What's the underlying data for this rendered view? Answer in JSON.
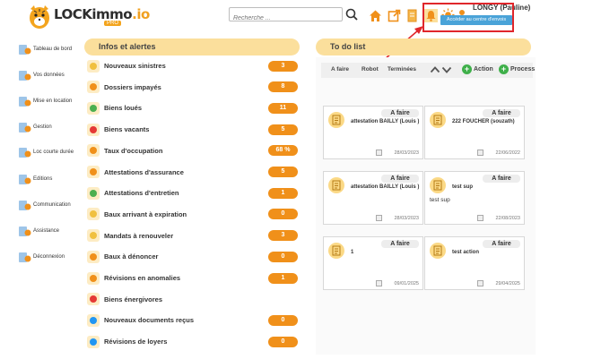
{
  "header": {
    "brand_main": "LOCKimmo",
    "brand_accent": ".io",
    "brand_badge": "PRO",
    "search_placeholder": "Recherche ...",
    "user_name": "LONGY (Pauline)",
    "tooltip": "Accéder au centre d'envois",
    "icons": [
      "home-icon",
      "external-link-icon",
      "document-icon",
      "notification-center-icon",
      "sun-icon",
      "status-dot-icon"
    ]
  },
  "sidebar": {
    "items": [
      {
        "label": "Tableau de bord",
        "icon": "dashboard-icon"
      },
      {
        "label": "Vos données",
        "icon": "person-icon"
      },
      {
        "label": "Mise en location",
        "icon": "key-icon"
      },
      {
        "label": "Gestion",
        "icon": "folder-icon"
      },
      {
        "label": "Loc courte durée",
        "icon": "suitcase-icon"
      },
      {
        "label": "Editions",
        "icon": "print-icon"
      },
      {
        "label": "Communication",
        "icon": "chat-icon"
      },
      {
        "label": "Assistance",
        "icon": "support-icon"
      },
      {
        "label": "Déconnexion",
        "icon": "logout-icon"
      }
    ]
  },
  "alerts": {
    "title": "Infos et alertes",
    "rows": [
      {
        "label": "Nouveaux sinistres",
        "count": "3",
        "icon": "warning-icon"
      },
      {
        "label": "Dossiers impayés",
        "count": "8",
        "icon": "unpaid-icon"
      },
      {
        "label": "Biens loués",
        "count": "11",
        "icon": "house-rented-icon"
      },
      {
        "label": "Biens vacants",
        "count": "5",
        "icon": "house-vacant-icon"
      },
      {
        "label": "Taux d'occupation",
        "count": "68 %",
        "icon": "chart-icon"
      },
      {
        "label": "Attestations d'assurance",
        "count": "5",
        "icon": "insurance-icon"
      },
      {
        "label": "Attestations d'entretien",
        "count": "1",
        "icon": "maintenance-icon"
      },
      {
        "label": "Baux arrivant à expiration",
        "count": "0",
        "icon": "lease-expiry-icon"
      },
      {
        "label": "Mandats à renouveler",
        "count": "3",
        "icon": "mandate-icon"
      },
      {
        "label": "Baux à dénoncer",
        "count": "0",
        "icon": "lease-terminate-icon"
      },
      {
        "label": "Révisions en anomalies",
        "count": "1",
        "icon": "revision-anomaly-icon"
      },
      {
        "label": "Biens énergivores",
        "count": "",
        "icon": "energy-icon"
      },
      {
        "label": "Nouveaux documents reçus",
        "count": "0",
        "icon": "download-icon"
      },
      {
        "label": "Révisions de loyers",
        "count": "0",
        "icon": "rent-revision-icon"
      }
    ]
  },
  "todo": {
    "title": "To do list",
    "tabs": [
      "A faire",
      "Robot",
      "Terminées"
    ],
    "action_label": "Action",
    "process_label": "Process",
    "cards": [
      {
        "status": "A faire",
        "title": "attestation BAILLY (Louis )",
        "desc": "",
        "date": "28/03/2023"
      },
      {
        "status": "A faire",
        "title": "222 FOUCHER (souzath)",
        "desc": "",
        "date": "22/06/2022"
      },
      {
        "status": "A faire",
        "title": "attestation BAILLY (Louis )",
        "desc": "",
        "date": "28/03/2023"
      },
      {
        "status": "A faire",
        "title": "test sup",
        "desc": "test sup",
        "date": "22/08/2023"
      },
      {
        "status": "A faire",
        "title": "1",
        "desc": "",
        "date": "09/01/2025"
      },
      {
        "status": "A faire",
        "title": "test action",
        "desc": "",
        "date": "29/04/2025"
      }
    ]
  },
  "colors": {
    "accent": "#f0901a",
    "panel_header": "#fbdf9c",
    "highlight": "#e0262b",
    "tooltip": "#4aa3d8",
    "green": "#3fb04a"
  }
}
